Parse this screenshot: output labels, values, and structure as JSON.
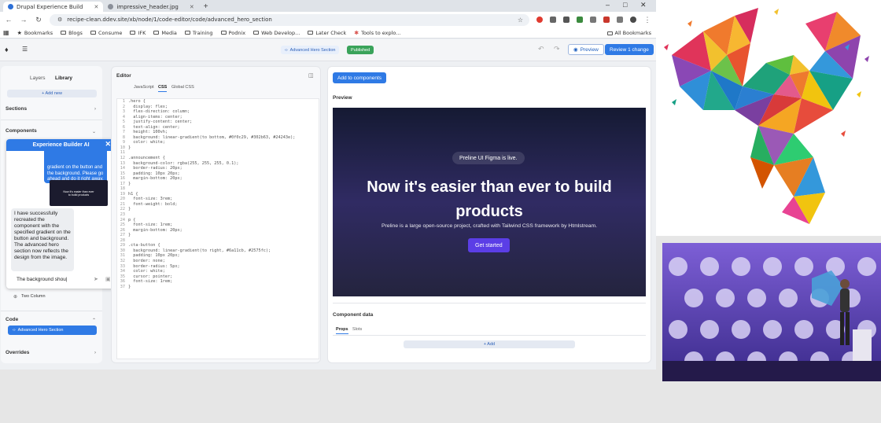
{
  "browser": {
    "tabs": [
      {
        "label": "Drupal Experience Build",
        "active": true
      },
      {
        "label": "impressive_header.jpg",
        "active": false
      }
    ],
    "url": "recipe-clean.ddev.site/xb/node/1/code-editor/code/advanced_hero_section",
    "bookmarks": [
      "Bookmarks",
      "Blogs",
      "Consume",
      "IFK",
      "Media",
      "Training",
      "Podnix",
      "Web Develop...",
      "Later Check",
      "Tools to explo..."
    ],
    "all_bookmarks": "All Bookmarks"
  },
  "app": {
    "breadcrumb": "Advanced Hero Section",
    "status": "Published",
    "preview_label": "Preview",
    "review_label": "Review 1 change"
  },
  "left_panel": {
    "tabs": [
      "Layers",
      "Library"
    ],
    "add_new": "+ Add new",
    "sections_label": "Sections",
    "components_label": "Components",
    "two_column": "Two Column",
    "code_label": "Code",
    "code_item": "Advanced Hero Section",
    "overrides_label": "Overrides"
  },
  "ai_chat": {
    "title": "Experience Builder AI",
    "user_message": "gradient on the button and the background. Please go ahead and do it right away.",
    "thumb_line1": "Now it's easier than ever",
    "thumb_line2": "to build products",
    "bot_message": "I have successfully recreated the component with the specified gradient on the button and background. The advanced hero section now reflects the design from the image.",
    "input_value": "The background shou"
  },
  "editor": {
    "title": "Editor",
    "tabs": [
      "JavaScript",
      "CSS",
      "Global CSS"
    ],
    "active_tab": "CSS",
    "lines": [
      ".hero {",
      "  display: flex;",
      "  flex-direction: column;",
      "  align-items: center;",
      "  justify-content: center;",
      "  text-align: center;",
      "  height: 100vh;",
      "  background: linear-gradient(to bottom, #0f0c29, #302b63, #24243e);",
      "  color: white;",
      "}",
      "",
      ".announcement {",
      "  background-color: rgba(255, 255, 255, 0.1);",
      "  border-radius: 20px;",
      "  padding: 10px 20px;",
      "  margin-bottom: 20px;",
      "}",
      "",
      "h1 {",
      "  font-size: 3rem;",
      "  font-weight: bold;",
      "}",
      "",
      "p {",
      "  font-size: 1rem;",
      "  margin-bottom: 20px;",
      "}",
      "",
      ".cta-button {",
      "  background: linear-gradient(to right, #6a11cb, #2575fc);",
      "  padding: 10px 20px;",
      "  border: none;",
      "  border-radius: 5px;",
      "  color: white;",
      "  cursor: pointer;",
      "  font-size: 1rem;",
      "}"
    ]
  },
  "preview": {
    "add_button": "Add to components",
    "label": "Preview",
    "hero_badge": "Preline UI Figma is live.",
    "hero_title_line1": "Now it's easier than ever to build",
    "hero_title_line2": "products",
    "hero_subtitle": "Preline is a large open-source project, crafted with Tailwind CSS framework by Htmlstream.",
    "hero_button": "Get started",
    "component_data": "Component data",
    "data_tabs": [
      "Props",
      "Slots"
    ],
    "add_label": "+ Add"
  },
  "colors": {
    "accent": "#2f7ae5",
    "published": "#3aa35a",
    "hero_top": "#151a33",
    "hero_mid": "#302b63",
    "hero_bottom": "#24243e",
    "cta": "#5b3ee6"
  }
}
